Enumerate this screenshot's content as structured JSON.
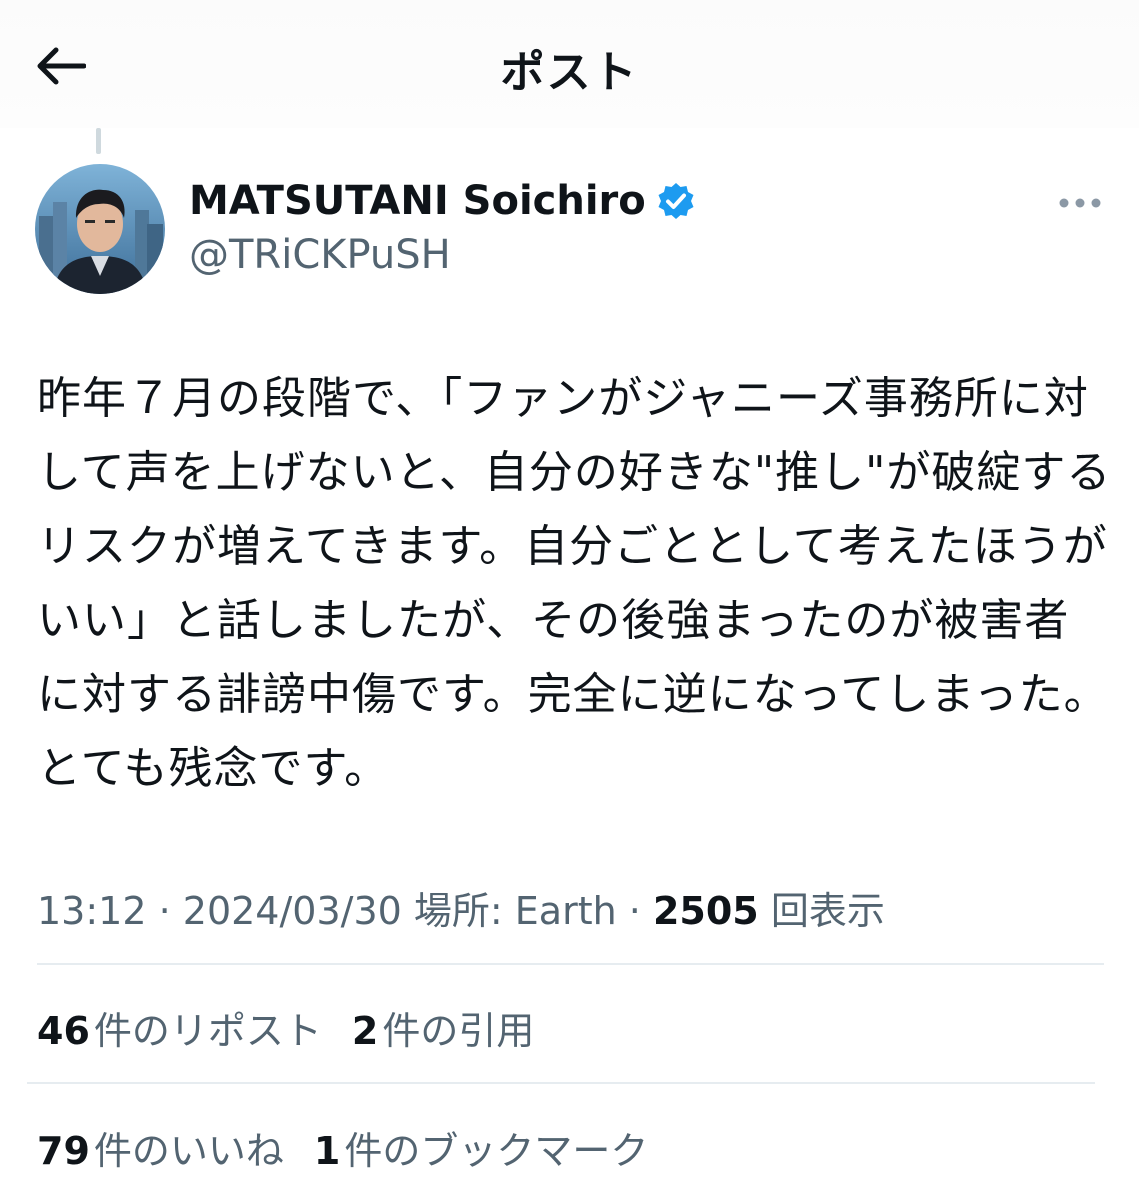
{
  "header": {
    "title": "ポスト"
  },
  "author": {
    "name": "MATSUTANI Soichiro",
    "handle": "@TRiCKPuSH",
    "verified": true
  },
  "tweet": {
    "text": "昨年７月の段階で、「ファンがジャニーズ事務所に対して声を上げないと、自分の好きな\"推し\"が破綻するリスクが増えてきます。自分ごととして考えたほうがいい」と話しましたが、その後強まったのが被害者に対する誹謗中傷です。完全に逆になってしまった。とても残念です。"
  },
  "meta": {
    "time": "13:12",
    "date": "2024/03/30",
    "location": "場所: Earth",
    "views_count": "2505",
    "views_label": "回表示"
  },
  "stats": {
    "reposts_count": "46",
    "reposts_label": "件のリポスト",
    "quotes_count": "2",
    "quotes_label": "件の引用",
    "likes_count": "79",
    "likes_label": "件のいいね",
    "bookmarks_count": "1",
    "bookmarks_label": "件のブックマーク"
  },
  "colors": {
    "verified": "#1d9bf0",
    "secondary_text": "#536471",
    "primary_text": "#0f1419"
  }
}
